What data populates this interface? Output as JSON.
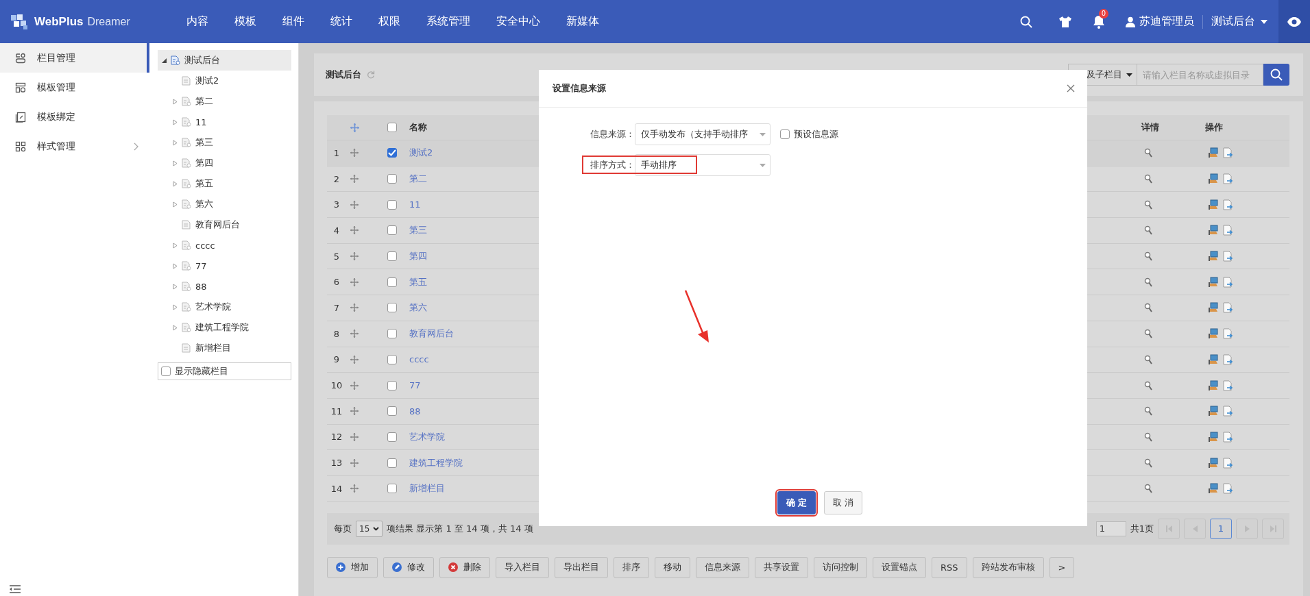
{
  "app": {
    "logo_primary": "WebPlus",
    "logo_secondary": "Dreamer"
  },
  "top_menu": [
    {
      "label": "内容"
    },
    {
      "label": "模板"
    },
    {
      "label": "组件"
    },
    {
      "label": "统计"
    },
    {
      "label": "权限"
    },
    {
      "label": "系统管理"
    },
    {
      "label": "安全中心"
    },
    {
      "label": "新媒体"
    }
  ],
  "notifications": {
    "count": "0"
  },
  "user": {
    "name": "苏迪管理员"
  },
  "site_switch": {
    "label": "测试后台"
  },
  "sidebar": {
    "items": [
      {
        "label": "栏目管理",
        "kind": "columns",
        "selected": true,
        "has_submenu": false
      },
      {
        "label": "模板管理",
        "kind": "templates",
        "selected": false,
        "has_submenu": false
      },
      {
        "label": "模板绑定",
        "kind": "binding",
        "selected": false,
        "has_submenu": false
      },
      {
        "label": "样式管理",
        "kind": "styles",
        "selected": false,
        "has_submenu": true
      }
    ]
  },
  "tree": {
    "root": {
      "label": "测试后台",
      "expanded": true,
      "selected": true,
      "children": [
        {
          "label": "测试2",
          "expandable": false
        },
        {
          "label": "第二",
          "expandable": true
        },
        {
          "label": "11",
          "expandable": true
        },
        {
          "label": "第三",
          "expandable": true
        },
        {
          "label": "第四",
          "expandable": true
        },
        {
          "label": "第五",
          "expandable": true
        },
        {
          "label": "第六",
          "expandable": true
        },
        {
          "label": "教育网后台",
          "expandable": false
        },
        {
          "label": "cccc",
          "expandable": true
        },
        {
          "label": "77",
          "expandable": true
        },
        {
          "label": "88",
          "expandable": true
        },
        {
          "label": "艺术学院",
          "expandable": true
        },
        {
          "label": "建筑工程学院",
          "expandable": true
        },
        {
          "label": "新增栏目",
          "expandable": false
        }
      ]
    },
    "show_hidden": {
      "label": "显示隐藏栏目",
      "checked": false
    }
  },
  "header": {
    "title": "测试后台"
  },
  "search": {
    "scope": "及子栏目",
    "placeholder": "请输入栏目名称或虚拟目录"
  },
  "table": {
    "all_selected": false,
    "columns": [
      "名称",
      "详情",
      "操作"
    ],
    "rows": [
      {
        "index": "1",
        "name": "测试2",
        "selected": true
      },
      {
        "index": "2",
        "name": "第二",
        "selected": false
      },
      {
        "index": "3",
        "name": "11",
        "selected": false
      },
      {
        "index": "4",
        "name": "第三",
        "selected": false
      },
      {
        "index": "5",
        "name": "第四",
        "selected": false
      },
      {
        "index": "6",
        "name": "第五",
        "selected": false
      },
      {
        "index": "7",
        "name": "第六",
        "selected": false
      },
      {
        "index": "8",
        "name": "教育网后台",
        "selected": false
      },
      {
        "index": "9",
        "name": "cccc",
        "selected": false
      },
      {
        "index": "10",
        "name": "77",
        "selected": false
      },
      {
        "index": "11",
        "name": "88",
        "selected": false
      },
      {
        "index": "12",
        "name": "艺术学院",
        "selected": false
      },
      {
        "index": "13",
        "name": "建筑工程学院",
        "selected": false
      },
      {
        "index": "14",
        "name": "新增栏目",
        "selected": false
      }
    ]
  },
  "pagination": {
    "per_page_label": "每页",
    "per_page": "15",
    "summary": "项结果 显示第 1 至 14 项，共 14 项",
    "page_input": "1",
    "total_pages": "共1页",
    "pages": [
      {
        "label": "1",
        "selected": true
      }
    ]
  },
  "toolbar": [
    {
      "label": "增加",
      "kind": "add"
    },
    {
      "label": "修改",
      "kind": "edit"
    },
    {
      "label": "删除",
      "kind": "delete"
    },
    {
      "label": "导入栏目",
      "kind": "plain"
    },
    {
      "label": "导出栏目",
      "kind": "plain"
    },
    {
      "label": "排序",
      "kind": "plain"
    },
    {
      "label": "移动",
      "kind": "plain"
    },
    {
      "label": "信息来源",
      "kind": "plain"
    },
    {
      "label": "共享设置",
      "kind": "plain"
    },
    {
      "label": "访问控制",
      "kind": "plain"
    },
    {
      "label": "设置锚点",
      "kind": "plain"
    },
    {
      "label": "RSS",
      "kind": "plain"
    },
    {
      "label": "跨站发布审核",
      "kind": "plain"
    },
    {
      "label": ">",
      "kind": "plain"
    }
  ],
  "dialog": {
    "title": "设置信息来源",
    "fields": [
      {
        "label": "信息来源：",
        "value": "仅手动发布（支持手动排序",
        "highlighted": false
      },
      {
        "label": "排序方式：",
        "value": "手动排序",
        "highlighted": true
      }
    ],
    "preset": {
      "label": "预设信息源",
      "checked": false
    },
    "buttons": [
      {
        "label": "确 定",
        "kind": "primary",
        "highlighted": true
      },
      {
        "label": "取 消",
        "kind": "secondary",
        "highlighted": false
      }
    ]
  }
}
